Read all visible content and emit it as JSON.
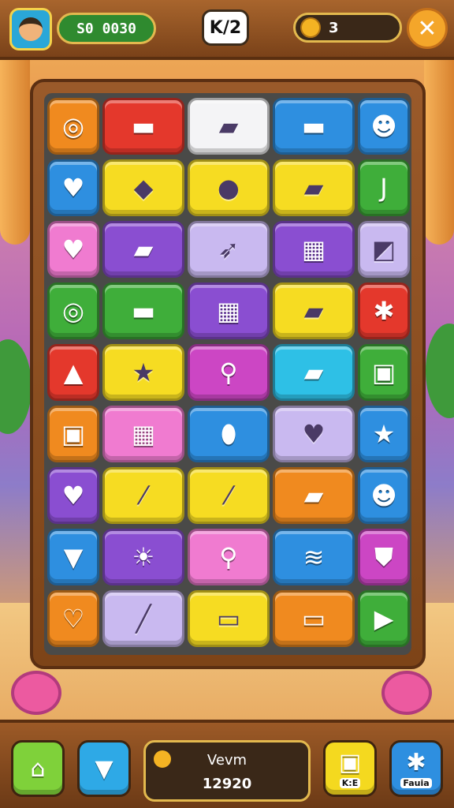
{
  "header": {
    "score": "S0 0030",
    "level": "K/2",
    "coins": "3"
  },
  "footer": {
    "panel_title": "Vevm",
    "panel_value": "12920",
    "button4_label": "K:E",
    "button5_label": "Fauia"
  },
  "colors": {
    "orange": "#f08a1f",
    "red": "#e4382c",
    "yellow": "#f6dc22",
    "blue": "#2e8fe0",
    "green": "#3fae3a",
    "purple": "#8a4ed1",
    "pink": "#f07bd0",
    "cyan": "#2ec0e6",
    "white": "#f4f4f6",
    "lavender": "#c9b9f0",
    "magenta": "#cc46c4"
  },
  "grid": [
    [
      {
        "color": "orange",
        "icon": "ring-icon",
        "glyph": "◎"
      },
      {
        "color": "red",
        "icon": "book-icon",
        "glyph": "▬"
      },
      {
        "color": "white",
        "icon": "chocolate-bar-icon",
        "glyph": "▰"
      },
      {
        "color": "blue",
        "icon": "book-icon",
        "glyph": "▬"
      },
      {
        "color": "blue",
        "icon": "creature-icon",
        "glyph": "☻"
      }
    ],
    [
      {
        "color": "blue",
        "icon": "heart-icon",
        "glyph": "♥"
      },
      {
        "color": "yellow",
        "icon": "gem-icon",
        "glyph": "◆"
      },
      {
        "color": "yellow",
        "icon": "speech-bubble-icon",
        "glyph": "●"
      },
      {
        "color": "yellow",
        "icon": "car-icon",
        "glyph": "▰"
      },
      {
        "color": "green",
        "icon": "hook-icon",
        "glyph": "J"
      }
    ],
    [
      {
        "color": "pink",
        "icon": "heart-icon",
        "glyph": "♥"
      },
      {
        "color": "purple",
        "icon": "crayon-icon",
        "glyph": "▰"
      },
      {
        "color": "lavender",
        "icon": "feather-icon",
        "glyph": "➶"
      },
      {
        "color": "purple",
        "icon": "cards-icon",
        "glyph": "▦"
      },
      {
        "color": "lavender",
        "icon": "cube-icon",
        "glyph": "◩"
      }
    ],
    [
      {
        "color": "green",
        "icon": "magnifier-icon",
        "glyph": "◎"
      },
      {
        "color": "green",
        "icon": "pill-icon",
        "glyph": "▬"
      },
      {
        "color": "purple",
        "icon": "tape-icon",
        "glyph": "▦"
      },
      {
        "color": "yellow",
        "icon": "car-icon",
        "glyph": "▰"
      },
      {
        "color": "red",
        "icon": "gear-icon",
        "glyph": "✱"
      }
    ],
    [
      {
        "color": "red",
        "icon": "triangle-icon",
        "glyph": "▲"
      },
      {
        "color": "yellow",
        "icon": "star-icon",
        "glyph": "★"
      },
      {
        "color": "magenta",
        "icon": "bottle-icon",
        "glyph": "⚲"
      },
      {
        "color": "cyan",
        "icon": "van-icon",
        "glyph": "▰"
      },
      {
        "color": "green",
        "icon": "box-icon",
        "glyph": "▣"
      }
    ],
    [
      {
        "color": "orange",
        "icon": "card-icon",
        "glyph": "▣"
      },
      {
        "color": "pink",
        "icon": "card-icon",
        "glyph": "▦"
      },
      {
        "color": "blue",
        "icon": "pill-icon",
        "glyph": "⬮"
      },
      {
        "color": "lavender",
        "icon": "heart-icon",
        "glyph": "♥"
      },
      {
        "color": "blue",
        "icon": "star-icon",
        "glyph": "★"
      }
    ],
    [
      {
        "color": "purple",
        "icon": "heart-icon",
        "glyph": "♥"
      },
      {
        "color": "yellow",
        "icon": "crayon-icon",
        "glyph": "⁄"
      },
      {
        "color": "yellow",
        "icon": "crayon-icon",
        "glyph": "⁄"
      },
      {
        "color": "orange",
        "icon": "car-icon",
        "glyph": "▰"
      },
      {
        "color": "blue",
        "icon": "creature-icon",
        "glyph": "☻"
      }
    ],
    [
      {
        "color": "blue",
        "icon": "cup-icon",
        "glyph": "▼"
      },
      {
        "color": "purple",
        "icon": "sun-icon",
        "glyph": "☀"
      },
      {
        "color": "pink",
        "icon": "key-icon",
        "glyph": "⚲"
      },
      {
        "color": "blue",
        "icon": "ribbon-icon",
        "glyph": "≋"
      },
      {
        "color": "magenta",
        "icon": "shield-icon",
        "glyph": "⛊"
      }
    ],
    [
      {
        "color": "orange",
        "icon": "heart-icon",
        "glyph": "♡"
      },
      {
        "color": "lavender",
        "icon": "tool-icon",
        "glyph": "╱"
      },
      {
        "color": "yellow",
        "icon": "scroll-icon",
        "glyph": "▭"
      },
      {
        "color": "orange",
        "icon": "ticket-icon",
        "glyph": "▭"
      },
      {
        "color": "green",
        "icon": "play-box-icon",
        "glyph": "▶"
      }
    ]
  ]
}
